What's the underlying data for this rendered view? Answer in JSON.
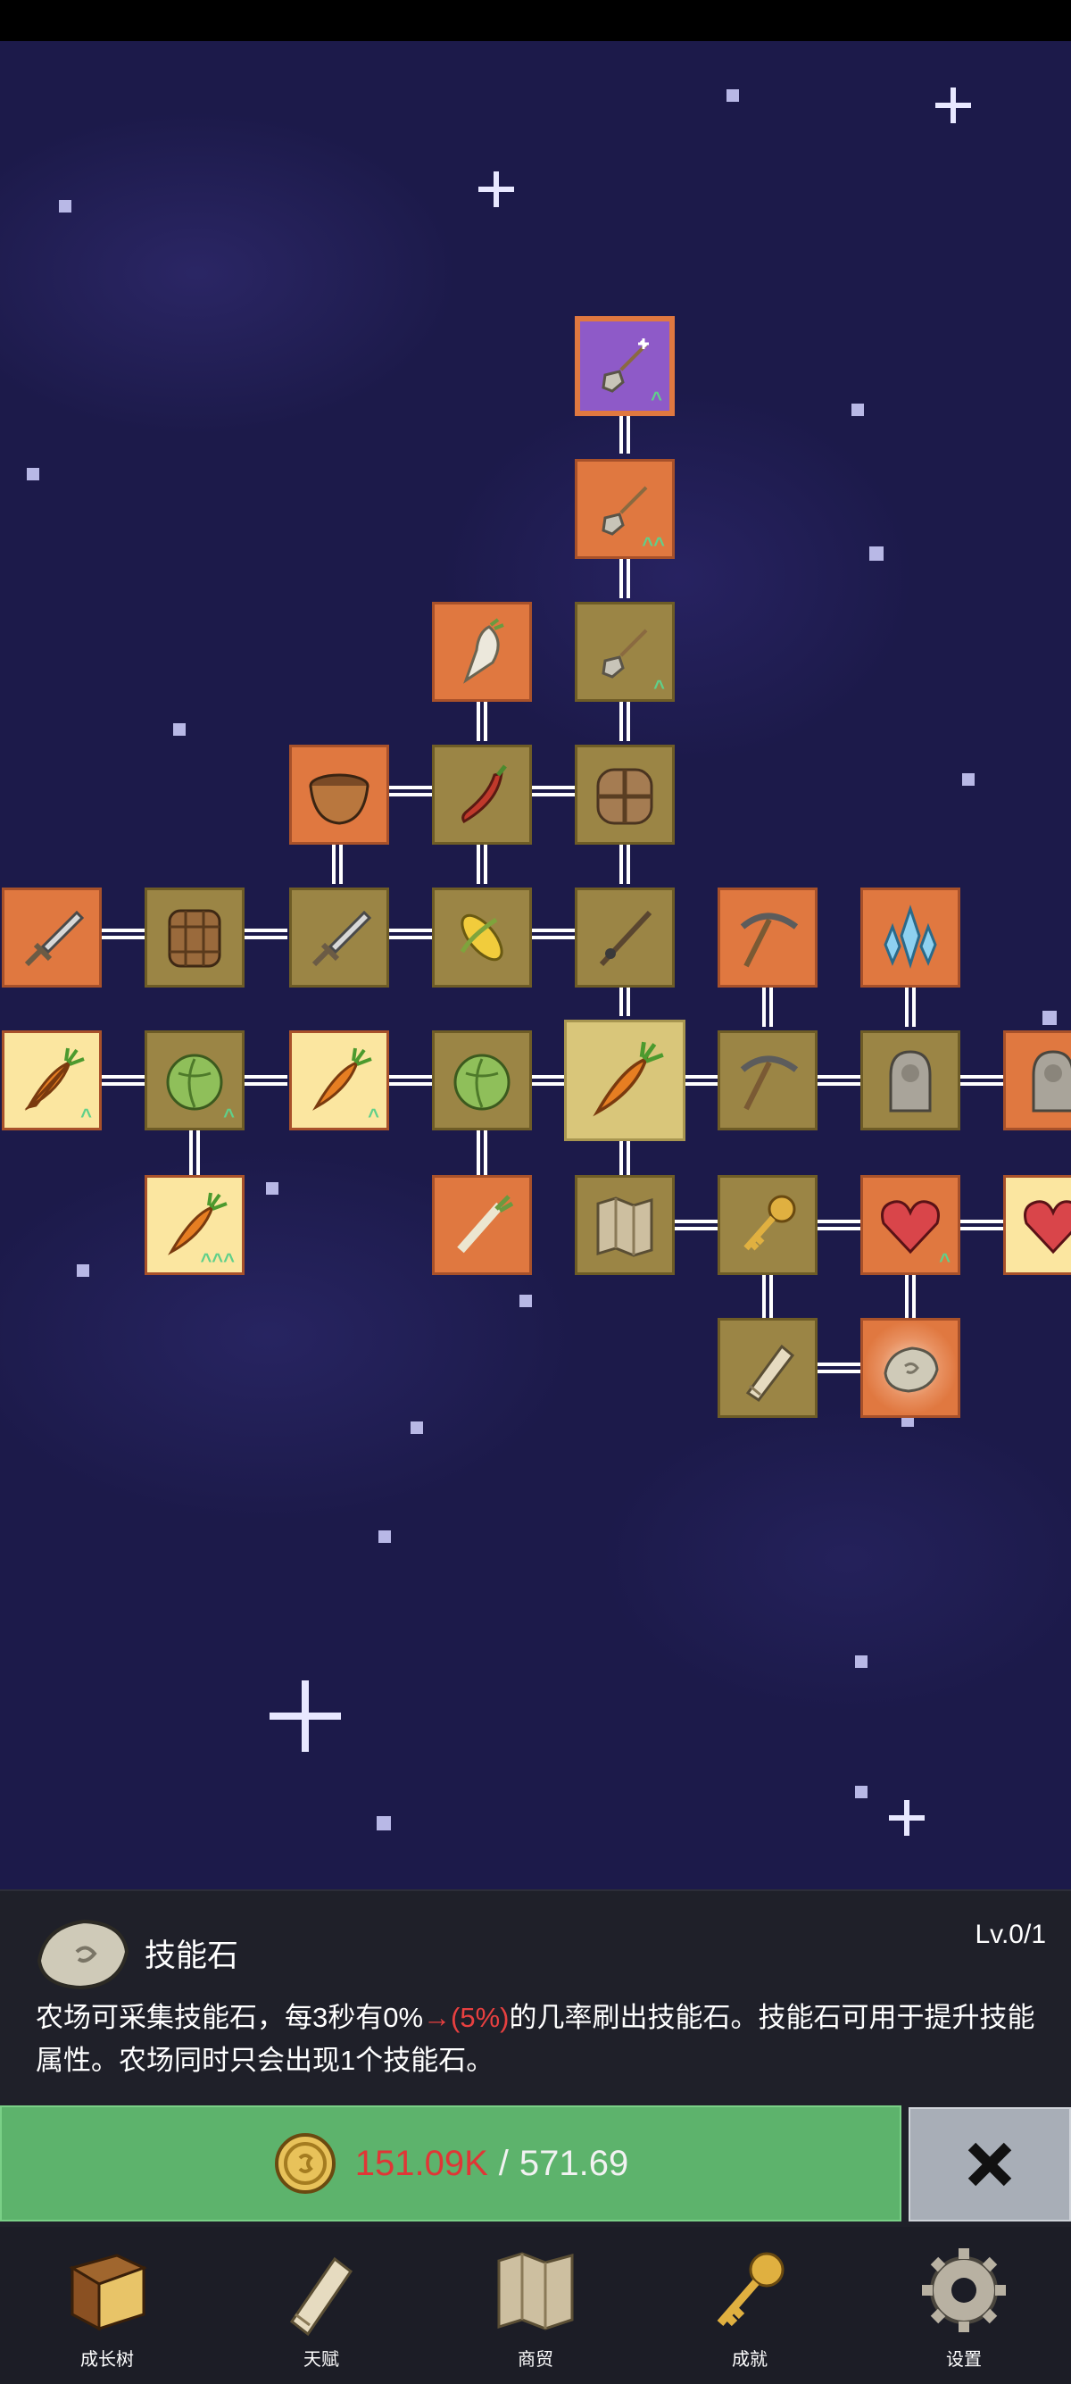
{
  "skill_tree": {
    "nodes": [
      {
        "id": "shovel-purple",
        "icon": "shovel-icon",
        "style": "purple",
        "upgrade": true
      },
      {
        "id": "shovel-orange",
        "icon": "shovel-icon",
        "style": "orange",
        "upgrade": true
      },
      {
        "id": "shovel-gold",
        "icon": "shovel-icon",
        "style": "gold",
        "upgrade": true
      },
      {
        "id": "radish",
        "icon": "radish-icon",
        "style": "orange"
      },
      {
        "id": "pot",
        "icon": "pot-icon",
        "style": "orange"
      },
      {
        "id": "chili",
        "icon": "chili-icon",
        "style": "gold"
      },
      {
        "id": "backpack",
        "icon": "backpack-icon",
        "style": "gold"
      },
      {
        "id": "sword-orange",
        "icon": "sword-icon",
        "style": "orange"
      },
      {
        "id": "barrel",
        "icon": "barrel-icon",
        "style": "gold"
      },
      {
        "id": "sword-gold",
        "icon": "sword-icon",
        "style": "gold"
      },
      {
        "id": "corn",
        "icon": "corn-icon",
        "style": "gold"
      },
      {
        "id": "fishing-rod",
        "icon": "fishing-rod-icon",
        "style": "gold"
      },
      {
        "id": "pickaxe-orange",
        "icon": "pickaxe-icon",
        "style": "orange"
      },
      {
        "id": "crystal",
        "icon": "crystal-icon",
        "style": "orange"
      },
      {
        "id": "carrot-bright-1",
        "icon": "carrot-icon",
        "style": "orange",
        "upgrade": true
      },
      {
        "id": "cabbage-1",
        "icon": "cabbage-icon",
        "style": "gold",
        "upgrade": true
      },
      {
        "id": "carrot-bright-2",
        "icon": "carrot-icon",
        "style": "orange",
        "upgrade": true
      },
      {
        "id": "cabbage-2",
        "icon": "cabbage-icon",
        "style": "gold"
      },
      {
        "id": "carrot-center",
        "icon": "carrot-icon",
        "style": "selected"
      },
      {
        "id": "pickaxe-gold",
        "icon": "pickaxe-icon",
        "style": "gold"
      },
      {
        "id": "statue-1",
        "icon": "statue-icon",
        "style": "gold"
      },
      {
        "id": "statue-2",
        "icon": "statue-icon",
        "style": "orange"
      },
      {
        "id": "carrot-triple",
        "icon": "carrot-icon",
        "style": "orange",
        "upgrade": true
      },
      {
        "id": "leek",
        "icon": "leek-icon",
        "style": "orange"
      },
      {
        "id": "map",
        "icon": "map-icon",
        "style": "gold"
      },
      {
        "id": "key",
        "icon": "key-icon",
        "style": "gold"
      },
      {
        "id": "heart-1",
        "icon": "heart-icon",
        "style": "orange",
        "upgrade": true
      },
      {
        "id": "heart-2",
        "icon": "heart-icon",
        "style": "orange"
      },
      {
        "id": "scroll",
        "icon": "scroll-icon",
        "style": "gold"
      },
      {
        "id": "skill-stone",
        "icon": "stone-icon",
        "style": "glow"
      }
    ]
  },
  "detail": {
    "icon": "stone-icon",
    "title": "技能石",
    "level": "Lv.0/1",
    "desc_before": "农场可采集技能石，每3秒有0%",
    "desc_highlight": "→(5%)",
    "desc_after": "的几率刷出技能石。技能石可用于提升技能属性。农场同时只会出现1个技能石。"
  },
  "purchase": {
    "coin_icon": "coin-icon",
    "owned": "151.09K",
    "separator": "/",
    "cost": "571.69"
  },
  "close": {
    "icon": "close-icon"
  },
  "nav": [
    {
      "label": "成长树",
      "icon": "book-icon"
    },
    {
      "label": "天赋",
      "icon": "scroll-icon"
    },
    {
      "label": "商贸",
      "icon": "map-icon"
    },
    {
      "label": "成就",
      "icon": "key-icon"
    },
    {
      "label": "设置",
      "icon": "gear-icon"
    }
  ],
  "colors": {
    "space": "#1c1a4a",
    "node_gold": "#9b8545",
    "node_orange": "#e07840",
    "button_green": "#5db36c",
    "price_red": "#e03636"
  }
}
